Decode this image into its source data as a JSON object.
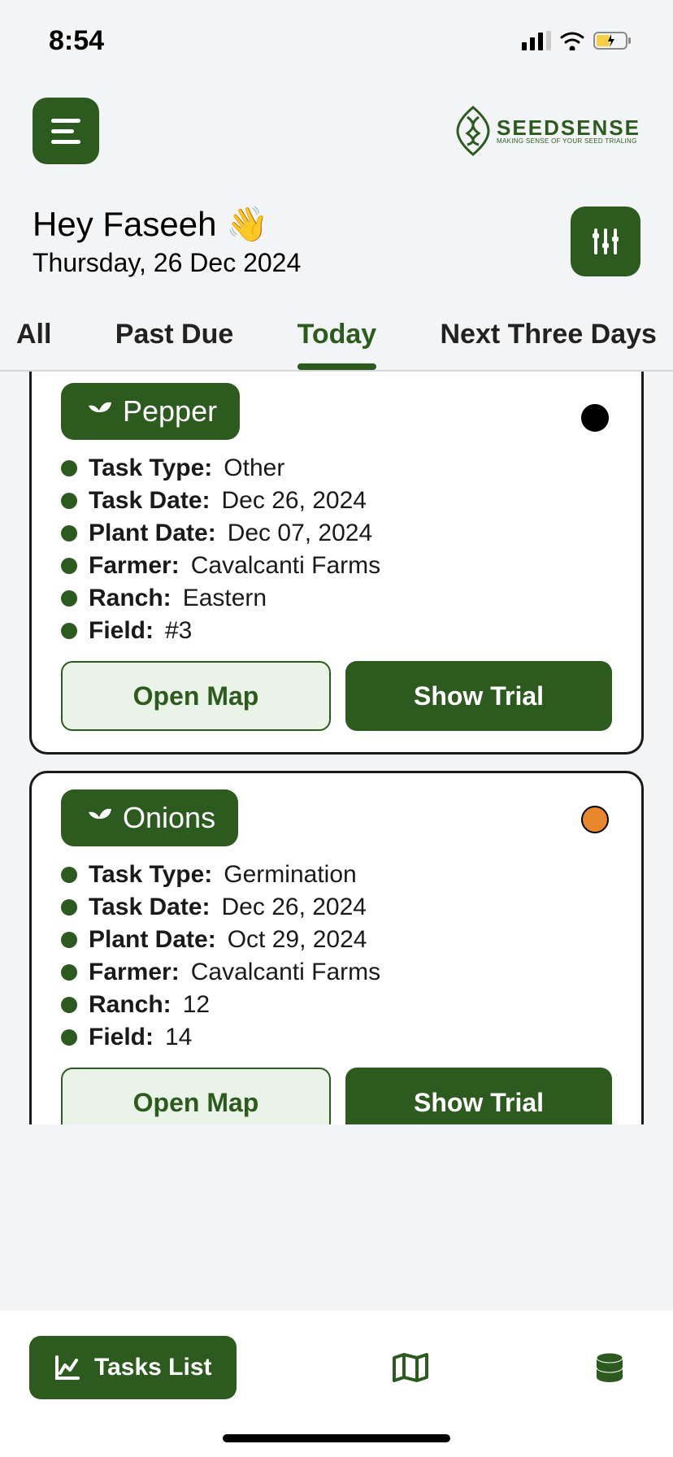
{
  "status": {
    "time": "8:54"
  },
  "brand": {
    "title": "SEEDSENSE",
    "subtitle": "MAKING SENSE OF YOUR SEED TRIALING"
  },
  "greeting": {
    "text": "Hey Faseeh 👋",
    "date": "Thursday, 26 Dec 2024"
  },
  "tabs": {
    "all": "All",
    "past_due": "Past Due",
    "today": "Today",
    "next_three": "Next Three Days",
    "active": "today"
  },
  "labels": {
    "task_type": "Task Type:",
    "task_date": "Task Date:",
    "plant_date": "Plant Date:",
    "farmer": "Farmer:",
    "ranch": "Ranch:",
    "field": "Field:",
    "open_map": "Open Map",
    "show_trial": "Show Trial"
  },
  "cards": [
    {
      "crop": "Pepper",
      "status_color": "#000000",
      "task_type": "Other",
      "task_date": "Dec 26, 2024",
      "plant_date": "Dec 07, 2024",
      "farmer": "Cavalcanti Farms",
      "ranch": "Eastern",
      "field": "#3"
    },
    {
      "crop": "Onions",
      "status_color": "#e8862e",
      "task_type": "Germination",
      "task_date": "Dec 26, 2024",
      "plant_date": "Oct 29, 2024",
      "farmer": "Cavalcanti Farms",
      "ranch": "12",
      "field": "14"
    }
  ],
  "bottom_nav": {
    "tasks_list": "Tasks List"
  }
}
